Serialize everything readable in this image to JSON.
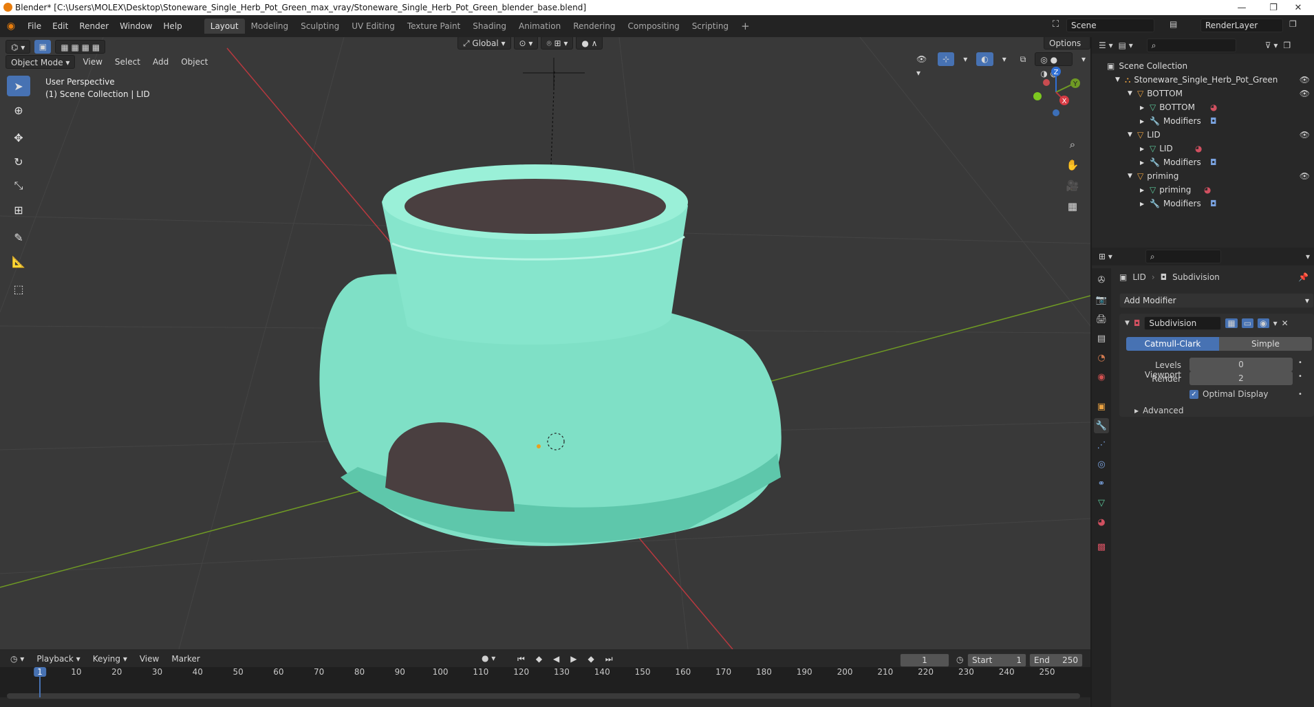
{
  "window": {
    "title": "Blender* [C:\\Users\\MOLEX\\Desktop\\Stoneware_Single_Herb_Pot_Green_max_vray/Stoneware_Single_Herb_Pot_Green_blender_base.blend]",
    "minimize": "—",
    "restore": "❐",
    "close": "✕"
  },
  "menu": [
    "File",
    "Edit",
    "Render",
    "Window",
    "Help"
  ],
  "workspaces": [
    "Layout",
    "Modeling",
    "Sculpting",
    "UV Editing",
    "Texture Paint",
    "Shading",
    "Animation",
    "Rendering",
    "Compositing",
    "Scripting"
  ],
  "active_workspace": "Layout",
  "scene_name": "Scene",
  "render_layer": "RenderLayer",
  "viewport": {
    "mode": "Object Mode",
    "menus": [
      "View",
      "Select",
      "Add",
      "Object"
    ],
    "transform_orientation": "Global",
    "options_label": "Options",
    "overlay_line1": "User Perspective",
    "overlay_line2": "(1) Scene Collection | LID",
    "gizmo_axes": [
      "Z",
      "Y",
      "X"
    ]
  },
  "outliner": {
    "root": "Scene Collection",
    "items": [
      {
        "label": "Stoneware_Single_Herb_Pot_Green",
        "indent": 1
      },
      {
        "label": "BOTTOM",
        "indent": 2
      },
      {
        "label": "BOTTOM",
        "indent": 3
      },
      {
        "label": "Modifiers",
        "indent": 3
      },
      {
        "label": "LID",
        "indent": 2
      },
      {
        "label": "LID",
        "indent": 3
      },
      {
        "label": "Modifiers",
        "indent": 3
      },
      {
        "label": "priming",
        "indent": 2
      },
      {
        "label": "priming",
        "indent": 3
      },
      {
        "label": "Modifiers",
        "indent": 3
      }
    ]
  },
  "properties": {
    "object": "LID",
    "modifier_crumb": "Subdivision",
    "add_modifier": "Add Modifier",
    "modifier_name": "Subdivision",
    "type_options": [
      "Catmull-Clark",
      "Simple"
    ],
    "active_type": "Catmull-Clark",
    "levels_viewport_label": "Levels Viewport",
    "levels_viewport_value": "0",
    "render_label": "Render",
    "render_value": "2",
    "optimal_display": "Optimal Display",
    "advanced": "Advanced"
  },
  "timeline": {
    "menus": [
      "Playback",
      "Keying",
      "View",
      "Marker"
    ],
    "current_frame": "1",
    "start_label": "Start",
    "start_value": "1",
    "end_label": "End",
    "end_value": "250",
    "ticks": [
      "1",
      "10",
      "20",
      "30",
      "40",
      "50",
      "60",
      "70",
      "80",
      "90",
      "100",
      "110",
      "120",
      "130",
      "140",
      "150",
      "160",
      "170",
      "180",
      "190",
      "200",
      "210",
      "220",
      "230",
      "240",
      "250"
    ]
  },
  "colors": {
    "accent": "#4772b3",
    "pot": "#7fe0c6",
    "soil": "#4a3f40",
    "x_axis": "#b8393f",
    "y_axis": "#6f9a24",
    "z_axis": "#2f6fd6"
  }
}
